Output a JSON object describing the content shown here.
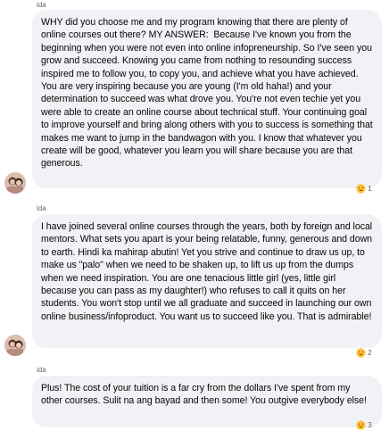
{
  "messages": [
    {
      "sender": "ida",
      "text": "WHY did you choose me and my program knowing that there are plenty of online courses out there? MY ANSWER:  Because I've known you from the beginning when you were not even into online infopreneurship. So I've seen you grow and succeed. Knowing you came from nothing to resounding success inspired me to follow you, to copy you, and achieve what you have achieved. You are very inspiring because you are young (I'm old haha!) and your determination to succeed was what drove you. You're not even techie yet you were able to create an online course about technical stuff. Your continuing goal to improve yourself and bring along others with you to success is something that makes me want to jump in the bandwagon with you. I know that whatever you create will be good, whatever you learn you will share because you are that generous.",
      "reaction_count": "1",
      "reaction_icon": "heart-eyes-emoji"
    },
    {
      "sender": "ida",
      "text": "I have joined several online courses through the years, both by foreign and local mentors. What sets you apart is your being relatable, funny, generous and down to earth. Hindi ka mahirap abutin! Yet you strive and continue to draw us up, to make us \"palo\" when we need to be shaken up, to lift us up from the dumps when we need inspiration. You are one tenacious little girl (yes, little girl because you can pass as my daughter!) who refuses to call it quits on her students. You won't stop until we all graduate and succeed in launching our own online business/infoproduct. You want us to succeed like you. That is admirable!",
      "reaction_count": "2",
      "reaction_icon": "heart-eyes-emoji"
    },
    {
      "sender": "ida",
      "text": "Plus! The cost of your tuition is a far cry from the dollars I've spent from my other courses. Sulit na ang bayad and then some! You outgive everybody else!",
      "reaction_count": "3",
      "reaction_icon": "heart-eyes-emoji"
    }
  ],
  "colors": {
    "bubble_bg": "#f0f2f5",
    "text": "#050505",
    "meta": "#65676b"
  }
}
